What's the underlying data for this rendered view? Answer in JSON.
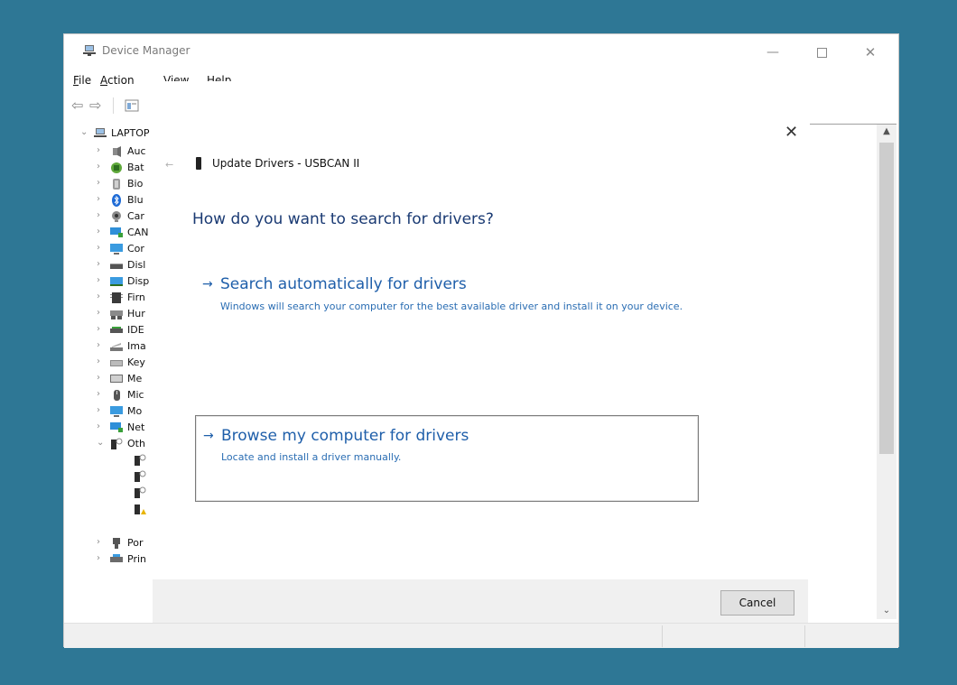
{
  "window": {
    "title": "Device Manager",
    "controls": {
      "minimize": "—",
      "close": "✕"
    }
  },
  "menu": {
    "file": {
      "mnemonic": "F",
      "rest": "ile"
    },
    "action": {
      "mnemonic": "A",
      "rest": "ction"
    },
    "view": {
      "mnemonic": "V",
      "rest": "iew"
    },
    "help": {
      "mnemonic": "H",
      "rest": "elp"
    }
  },
  "toolbar": {
    "back_icon": "⇦",
    "forward_icon": "⇨",
    "uninstall_icon": "✕",
    "download_icon": "⊕"
  },
  "tree": {
    "root": {
      "chevron": "⌄",
      "label": "LAPTOP"
    },
    "items": [
      {
        "chevron": "›",
        "label": "Auc"
      },
      {
        "chevron": "›",
        "label": "Bat"
      },
      {
        "chevron": "›",
        "label": "Bio"
      },
      {
        "chevron": "›",
        "label": "Blu"
      },
      {
        "chevron": "›",
        "label": "Car"
      },
      {
        "chevron": "›",
        "label": "CAN"
      },
      {
        "chevron": "›",
        "label": "Cor"
      },
      {
        "chevron": "›",
        "label": "Disl"
      },
      {
        "chevron": "›",
        "label": "Disp"
      },
      {
        "chevron": "›",
        "label": "Firn"
      },
      {
        "chevron": "›",
        "label": "Hur"
      },
      {
        "chevron": "›",
        "label": "IDE"
      },
      {
        "chevron": "›",
        "label": "Ima"
      },
      {
        "chevron": "›",
        "label": "Key"
      },
      {
        "chevron": "›",
        "label": "Me"
      },
      {
        "chevron": "›",
        "label": "Mic"
      },
      {
        "chevron": "›",
        "label": "Mo"
      },
      {
        "chevron": "›",
        "label": "Net"
      },
      {
        "chevron": "⌄",
        "label": "Oth"
      }
    ],
    "other_children_count": 4,
    "after": [
      {
        "chevron": "›",
        "label": "Por"
      },
      {
        "chevron": "›",
        "label": "Prin"
      }
    ]
  },
  "scrollbar": {
    "up": "▲",
    "down": "⌄"
  },
  "dialog": {
    "close_icon": "✕",
    "back_icon": "←",
    "title": "Update Drivers - USBCAN II",
    "heading": "How do you want to search for drivers?",
    "option_arrow": "→",
    "options": [
      {
        "title": "Search automatically for drivers",
        "description": "Windows will search your computer for the best available driver and install it on your device."
      },
      {
        "title": "Browse my computer for drivers",
        "description": "Locate and install a driver manually."
      }
    ],
    "cancel_label": "Cancel"
  }
}
